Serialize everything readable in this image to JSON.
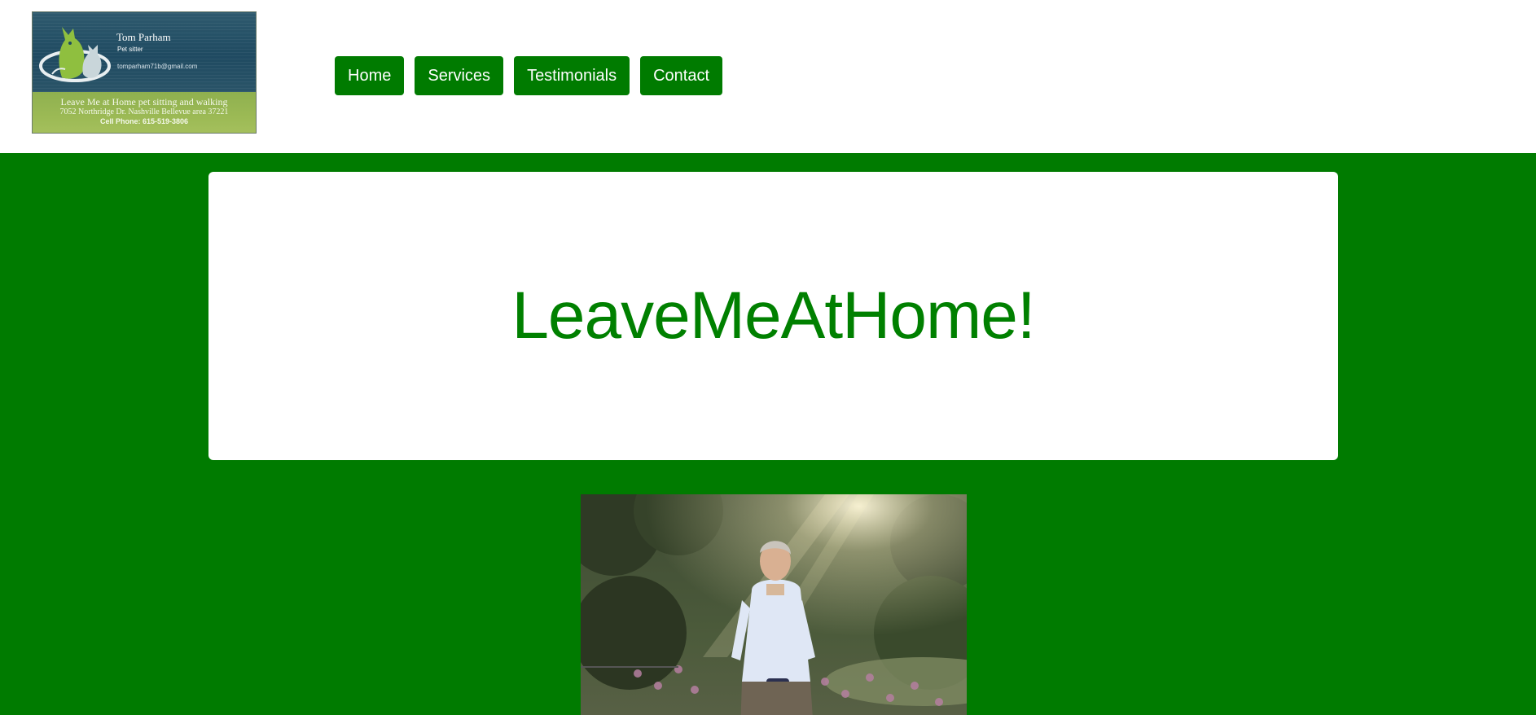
{
  "header": {
    "logo": {
      "name": "Tom Parham",
      "role": "Pet sitter",
      "email": "tomparham71b@gmail.com",
      "tagline": "Leave Me at Home pet sitting and walking",
      "address": "7052 Northridge Dr. Nashville Bellevue area 37221",
      "phone": "Cell Phone: 615-519-3806"
    },
    "nav": [
      {
        "label": "Home"
      },
      {
        "label": "Services"
      },
      {
        "label": "Testimonials"
      },
      {
        "label": "Contact"
      }
    ]
  },
  "hero": {
    "title": "LeaveMeAtHome!"
  },
  "colors": {
    "brand_green": "#007b00",
    "title_green": "#008000",
    "panel": "#ffffff"
  },
  "icons": {
    "logo_emblem": "dog-cat-emblem-icon"
  }
}
